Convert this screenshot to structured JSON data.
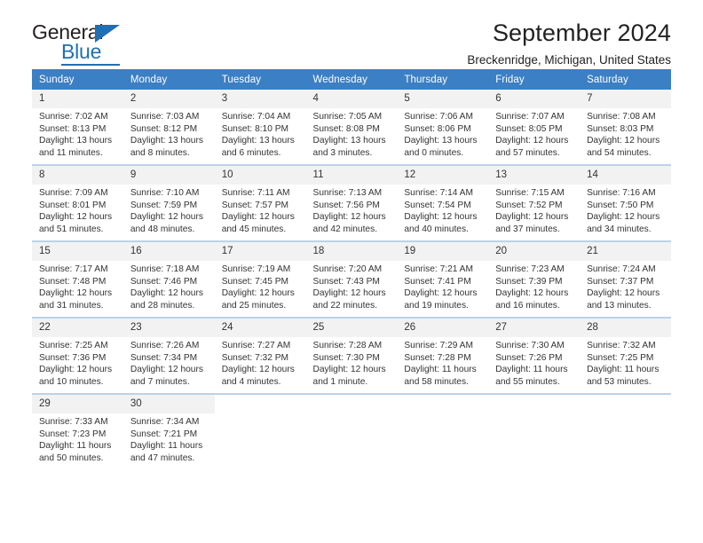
{
  "logo": {
    "word_top": "General",
    "word_bottom": "Blue",
    "accent_color": "#1f6fb5"
  },
  "header": {
    "title": "September 2024",
    "location": "Breckenridge, Michigan, United States",
    "header_bg_color": "#3b7fc4",
    "daynum_bg_color": "#f2f2f2"
  },
  "weekdays": [
    "Sunday",
    "Monday",
    "Tuesday",
    "Wednesday",
    "Thursday",
    "Friday",
    "Saturday"
  ],
  "weeks": [
    [
      {
        "day": "1",
        "sunrise": "Sunrise: 7:02 AM",
        "sunset": "Sunset: 8:13 PM",
        "daylight1": "Daylight: 13 hours",
        "daylight2": "and 11 minutes."
      },
      {
        "day": "2",
        "sunrise": "Sunrise: 7:03 AM",
        "sunset": "Sunset: 8:12 PM",
        "daylight1": "Daylight: 13 hours",
        "daylight2": "and 8 minutes."
      },
      {
        "day": "3",
        "sunrise": "Sunrise: 7:04 AM",
        "sunset": "Sunset: 8:10 PM",
        "daylight1": "Daylight: 13 hours",
        "daylight2": "and 6 minutes."
      },
      {
        "day": "4",
        "sunrise": "Sunrise: 7:05 AM",
        "sunset": "Sunset: 8:08 PM",
        "daylight1": "Daylight: 13 hours",
        "daylight2": "and 3 minutes."
      },
      {
        "day": "5",
        "sunrise": "Sunrise: 7:06 AM",
        "sunset": "Sunset: 8:06 PM",
        "daylight1": "Daylight: 13 hours",
        "daylight2": "and 0 minutes."
      },
      {
        "day": "6",
        "sunrise": "Sunrise: 7:07 AM",
        "sunset": "Sunset: 8:05 PM",
        "daylight1": "Daylight: 12 hours",
        "daylight2": "and 57 minutes."
      },
      {
        "day": "7",
        "sunrise": "Sunrise: 7:08 AM",
        "sunset": "Sunset: 8:03 PM",
        "daylight1": "Daylight: 12 hours",
        "daylight2": "and 54 minutes."
      }
    ],
    [
      {
        "day": "8",
        "sunrise": "Sunrise: 7:09 AM",
        "sunset": "Sunset: 8:01 PM",
        "daylight1": "Daylight: 12 hours",
        "daylight2": "and 51 minutes."
      },
      {
        "day": "9",
        "sunrise": "Sunrise: 7:10 AM",
        "sunset": "Sunset: 7:59 PM",
        "daylight1": "Daylight: 12 hours",
        "daylight2": "and 48 minutes."
      },
      {
        "day": "10",
        "sunrise": "Sunrise: 7:11 AM",
        "sunset": "Sunset: 7:57 PM",
        "daylight1": "Daylight: 12 hours",
        "daylight2": "and 45 minutes."
      },
      {
        "day": "11",
        "sunrise": "Sunrise: 7:13 AM",
        "sunset": "Sunset: 7:56 PM",
        "daylight1": "Daylight: 12 hours",
        "daylight2": "and 42 minutes."
      },
      {
        "day": "12",
        "sunrise": "Sunrise: 7:14 AM",
        "sunset": "Sunset: 7:54 PM",
        "daylight1": "Daylight: 12 hours",
        "daylight2": "and 40 minutes."
      },
      {
        "day": "13",
        "sunrise": "Sunrise: 7:15 AM",
        "sunset": "Sunset: 7:52 PM",
        "daylight1": "Daylight: 12 hours",
        "daylight2": "and 37 minutes."
      },
      {
        "day": "14",
        "sunrise": "Sunrise: 7:16 AM",
        "sunset": "Sunset: 7:50 PM",
        "daylight1": "Daylight: 12 hours",
        "daylight2": "and 34 minutes."
      }
    ],
    [
      {
        "day": "15",
        "sunrise": "Sunrise: 7:17 AM",
        "sunset": "Sunset: 7:48 PM",
        "daylight1": "Daylight: 12 hours",
        "daylight2": "and 31 minutes."
      },
      {
        "day": "16",
        "sunrise": "Sunrise: 7:18 AM",
        "sunset": "Sunset: 7:46 PM",
        "daylight1": "Daylight: 12 hours",
        "daylight2": "and 28 minutes."
      },
      {
        "day": "17",
        "sunrise": "Sunrise: 7:19 AM",
        "sunset": "Sunset: 7:45 PM",
        "daylight1": "Daylight: 12 hours",
        "daylight2": "and 25 minutes."
      },
      {
        "day": "18",
        "sunrise": "Sunrise: 7:20 AM",
        "sunset": "Sunset: 7:43 PM",
        "daylight1": "Daylight: 12 hours",
        "daylight2": "and 22 minutes."
      },
      {
        "day": "19",
        "sunrise": "Sunrise: 7:21 AM",
        "sunset": "Sunset: 7:41 PM",
        "daylight1": "Daylight: 12 hours",
        "daylight2": "and 19 minutes."
      },
      {
        "day": "20",
        "sunrise": "Sunrise: 7:23 AM",
        "sunset": "Sunset: 7:39 PM",
        "daylight1": "Daylight: 12 hours",
        "daylight2": "and 16 minutes."
      },
      {
        "day": "21",
        "sunrise": "Sunrise: 7:24 AM",
        "sunset": "Sunset: 7:37 PM",
        "daylight1": "Daylight: 12 hours",
        "daylight2": "and 13 minutes."
      }
    ],
    [
      {
        "day": "22",
        "sunrise": "Sunrise: 7:25 AM",
        "sunset": "Sunset: 7:36 PM",
        "daylight1": "Daylight: 12 hours",
        "daylight2": "and 10 minutes."
      },
      {
        "day": "23",
        "sunrise": "Sunrise: 7:26 AM",
        "sunset": "Sunset: 7:34 PM",
        "daylight1": "Daylight: 12 hours",
        "daylight2": "and 7 minutes."
      },
      {
        "day": "24",
        "sunrise": "Sunrise: 7:27 AM",
        "sunset": "Sunset: 7:32 PM",
        "daylight1": "Daylight: 12 hours",
        "daylight2": "and 4 minutes."
      },
      {
        "day": "25",
        "sunrise": "Sunrise: 7:28 AM",
        "sunset": "Sunset: 7:30 PM",
        "daylight1": "Daylight: 12 hours",
        "daylight2": "and 1 minute."
      },
      {
        "day": "26",
        "sunrise": "Sunrise: 7:29 AM",
        "sunset": "Sunset: 7:28 PM",
        "daylight1": "Daylight: 11 hours",
        "daylight2": "and 58 minutes."
      },
      {
        "day": "27",
        "sunrise": "Sunrise: 7:30 AM",
        "sunset": "Sunset: 7:26 PM",
        "daylight1": "Daylight: 11 hours",
        "daylight2": "and 55 minutes."
      },
      {
        "day": "28",
        "sunrise": "Sunrise: 7:32 AM",
        "sunset": "Sunset: 7:25 PM",
        "daylight1": "Daylight: 11 hours",
        "daylight2": "and 53 minutes."
      }
    ],
    [
      {
        "day": "29",
        "sunrise": "Sunrise: 7:33 AM",
        "sunset": "Sunset: 7:23 PM",
        "daylight1": "Daylight: 11 hours",
        "daylight2": "and 50 minutes."
      },
      {
        "day": "30",
        "sunrise": "Sunrise: 7:34 AM",
        "sunset": "Sunset: 7:21 PM",
        "daylight1": "Daylight: 11 hours",
        "daylight2": "and 47 minutes."
      },
      {
        "day": "",
        "sunrise": "",
        "sunset": "",
        "daylight1": "",
        "daylight2": ""
      },
      {
        "day": "",
        "sunrise": "",
        "sunset": "",
        "daylight1": "",
        "daylight2": ""
      },
      {
        "day": "",
        "sunrise": "",
        "sunset": "",
        "daylight1": "",
        "daylight2": ""
      },
      {
        "day": "",
        "sunrise": "",
        "sunset": "",
        "daylight1": "",
        "daylight2": ""
      },
      {
        "day": "",
        "sunrise": "",
        "sunset": "",
        "daylight1": "",
        "daylight2": ""
      }
    ]
  ]
}
